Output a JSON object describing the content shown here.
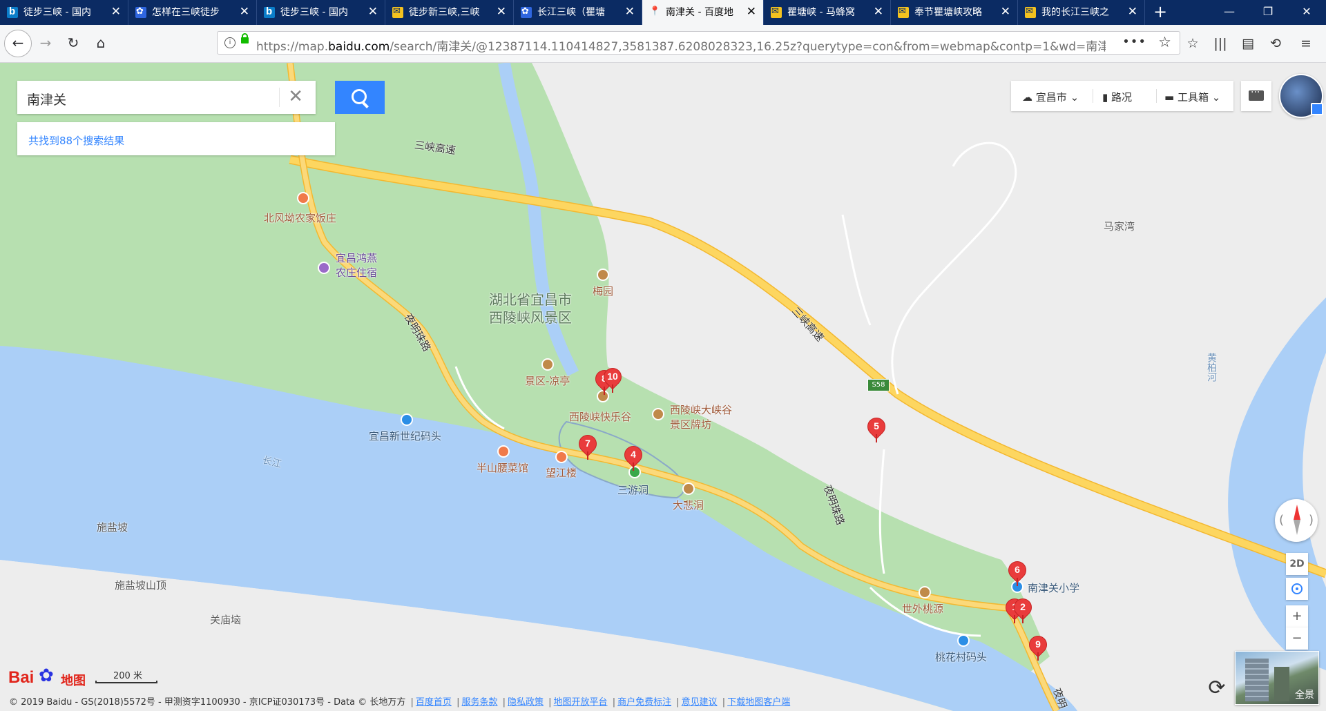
{
  "browser": {
    "tabs": [
      {
        "title": "徒步三峡 - 国内",
        "icon": "bing-icon"
      },
      {
        "title": "怎样在三峡徒步",
        "icon": "baidu-paw-icon"
      },
      {
        "title": "徒步三峡 - 国内",
        "icon": "bing-icon"
      },
      {
        "title": "徒步新三峡,三峡",
        "icon": "mafengwo-icon"
      },
      {
        "title": "长江三峡（瞿塘",
        "icon": "baidu-paw-icon"
      },
      {
        "title": "南津关 - 百度地",
        "icon": "map-pin-icon",
        "active": true
      },
      {
        "title": "瞿塘峡 - 马蜂窝",
        "icon": "mafengwo-icon"
      },
      {
        "title": "奉节瞿塘峡攻略",
        "icon": "mafengwo-icon"
      },
      {
        "title": "我的长江三峡之",
        "icon": "mafengwo-icon"
      }
    ],
    "url_prefix": "https://map.",
    "url_domain": "baidu.com",
    "url_rest": "/search/南津关/@12387114.110414827,3581387.6208028323,16.25z?querytype=con&from=webmap&contp=1&wd=南津关"
  },
  "search": {
    "query": "南津关",
    "result_text": "共找到88个搜索结果"
  },
  "tools": {
    "city": "宜昌市",
    "traffic": "路况",
    "toolbox": "工具箱"
  },
  "map": {
    "labels": {
      "highway1": "三峡高速",
      "highway2": "三峡高速",
      "road_yms1": "夜明珠路",
      "road_yms2": "夜明珠路",
      "road_yms3": "夜明",
      "scenic": [
        "湖北省宜昌市",
        "西陵峡风景区"
      ],
      "beifengao": "北风坳农家饭庄",
      "hongyan": [
        "宜昌鸿燕",
        "农庄住宿"
      ],
      "meiyuan": "梅园",
      "liangting": "景区-凉亭",
      "kuaile": "西陵峡快乐谷",
      "paifang": [
        "西陵峡大峡谷",
        "景区牌坊"
      ],
      "matou_new": "宜昌新世纪码头",
      "changjiang": "长江",
      "banshan": "半山腰菜馆",
      "wangjiang": "望江楼",
      "sanyou": "三游洞",
      "dabei": "大悲洞",
      "majiawan": "马家湾",
      "huangbai": "黄柏河",
      "s58": "S58",
      "shiyan": "施盐坡",
      "shiyan_top": "施盐坡山顶",
      "guanmiao": "关庙垴",
      "xiaoxue": "南津关小学",
      "taoyuan": "世外桃源",
      "taohua": "桃花村码头"
    },
    "pins": [
      "1",
      "2",
      "4",
      "5",
      "6",
      "7",
      "8",
      "9",
      "10"
    ],
    "scale_text": "200 米",
    "pano_text": "全景",
    "d2_text": "2D",
    "logo_bai": "Bai",
    "logo_ditu": "地图"
  },
  "footer": {
    "copyright": "© 2019 Baidu - GS(2018)5572号 - 甲测资字1100930 - 京ICP证030173号 - Data © 长地万方",
    "links": [
      "百度首页",
      "服务条款",
      "隐私政策",
      "地图开放平台",
      "商户免费标注",
      "意见建议",
      "下载地图客户端"
    ]
  },
  "colors": {
    "land_green": "#b7e0b0",
    "river": "#abcff7",
    "highway": "#fdcf50",
    "accent": "#3385ff",
    "pin": "#e93c3c"
  }
}
